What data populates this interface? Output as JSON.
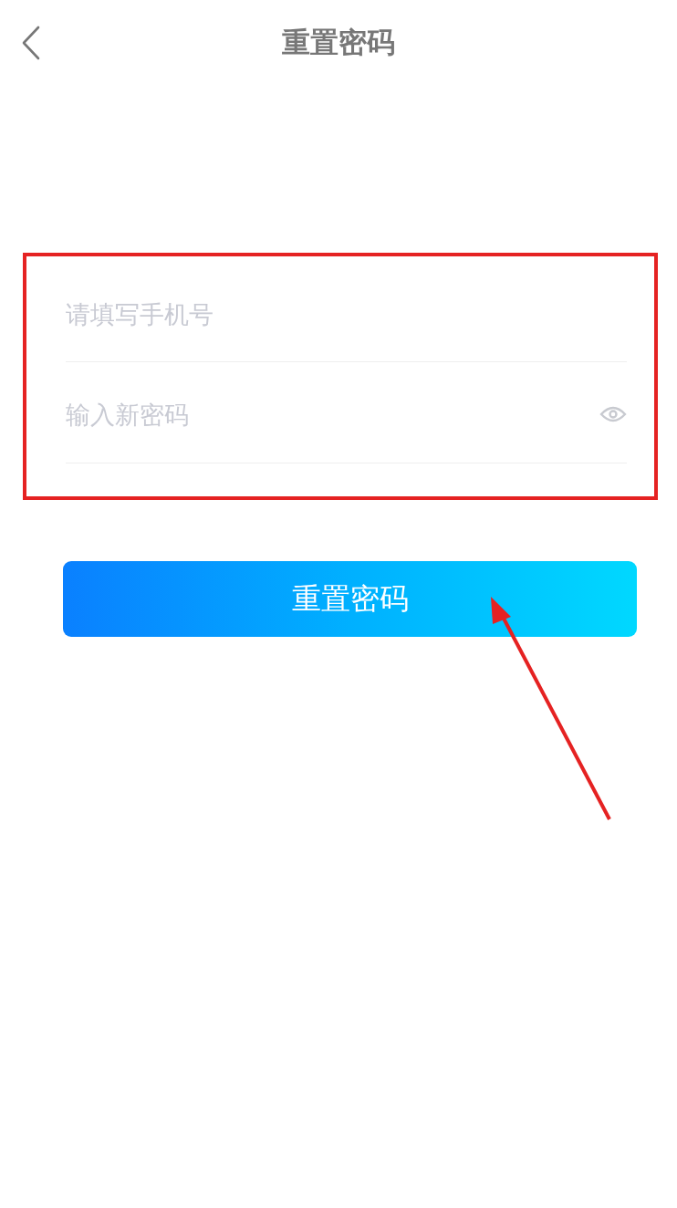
{
  "header": {
    "title": "重置密码"
  },
  "fields": [
    {
      "kind": "text",
      "placeholder": "请填写手机号"
    },
    {
      "kind": "password",
      "placeholder": "输入新密码"
    }
  ],
  "submit_button": {
    "label": "重置密码"
  }
}
